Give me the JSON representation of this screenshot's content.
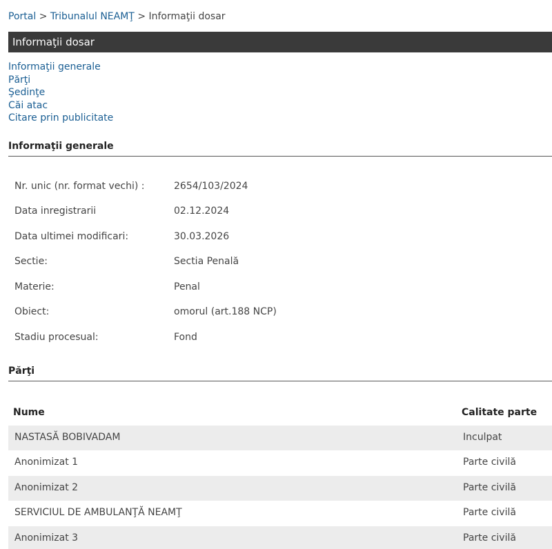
{
  "breadcrumb": {
    "portal": "Portal",
    "sep1": ">",
    "court": "Tribunalul NEAMŢ",
    "sep2": ">",
    "current": "Informaţii dosar"
  },
  "title": "Informaţii dosar",
  "nav": [
    "Informaţii generale",
    "Părţi",
    "Şedinţe",
    "Căi atac",
    "Citare prin publicitate"
  ],
  "general": {
    "heading": "Informaţii generale",
    "rows": [
      {
        "label": "Nr. unic (nr. format vechi) :",
        "value": "2654/103/2024"
      },
      {
        "label": "Data inregistrarii",
        "value": "02.12.2024"
      },
      {
        "label": "Data ultimei modificari:",
        "value": "30.03.2026"
      },
      {
        "label": "Sectie:",
        "value": "Sectia Penală"
      },
      {
        "label": "Materie:",
        "value": "Penal"
      },
      {
        "label": "Obiect:",
        "value": "omorul (art.188 NCP)"
      },
      {
        "label": "Stadiu procesual:",
        "value": "Fond"
      }
    ]
  },
  "parties": {
    "heading": "Părţi",
    "columns": [
      "Nume",
      "Calitate parte"
    ],
    "rows": [
      {
        "name": "NASTASĂ BOBIVADAM",
        "role": "Inculpat"
      },
      {
        "name": "Anonimizat 1",
        "role": "Parte civilă"
      },
      {
        "name": "Anonimizat 2",
        "role": "Parte civilă"
      },
      {
        "name": "SERVICIUL DE AMBULANŢĂ NEAMŢ",
        "role": "Parte civilă"
      },
      {
        "name": "Anonimizat 3",
        "role": "Parte civilă"
      }
    ]
  }
}
